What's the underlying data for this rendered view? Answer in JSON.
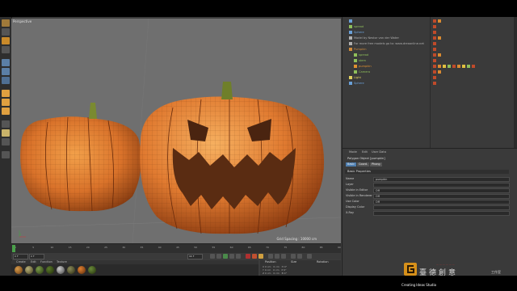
{
  "viewport": {
    "title": "Perspective",
    "grid_spacing": "Grid Spacing : 10000 cm"
  },
  "object_manager": {
    "objects": [
      {
        "name": "",
        "indent": 0,
        "color": "#6aa0d8"
      },
      {
        "name": "spread",
        "indent": 0,
        "color": "#8fbf5a"
      },
      {
        "name": "Sphere",
        "indent": 0,
        "color": "#6aa0d8"
      },
      {
        "name": "Model by Nestor van der Water",
        "indent": 0,
        "color": "#b0b0b0"
      },
      {
        "name": "For more free models go to: www.dreaonline.net",
        "indent": 0,
        "color": "#b0b0b0"
      },
      {
        "name": "Pumpkin",
        "indent": 0,
        "color": "#d08a3a"
      },
      {
        "name": "spread",
        "indent": 1,
        "color": "#8fbf5a"
      },
      {
        "name": "stem",
        "indent": 1,
        "color": "#8fbf5a"
      },
      {
        "name": "pumpkin",
        "indent": 1,
        "color": "#e09030"
      },
      {
        "name": "Camera",
        "indent": 1,
        "color": "#8fbf5a"
      },
      {
        "name": "Light",
        "indent": 0,
        "color": "#e0d060"
      },
      {
        "name": "Sphere",
        "indent": 0,
        "color": "#6aa0d8"
      }
    ]
  },
  "attributes": {
    "menu": [
      "Mode",
      "Edit",
      "User Data"
    ],
    "object_name": "Polygon Object [pumpkin]",
    "tabs": [
      "Basic",
      "Coord.",
      "Phong"
    ],
    "section": "Basic Properties",
    "rows": [
      {
        "label": "Name",
        "value": "pumpkin"
      },
      {
        "label": "Layer",
        "value": ""
      },
      {
        "label": "Visible in Editor",
        "value": "Off"
      },
      {
        "label": "Visible in Renderer",
        "value": "Off"
      },
      {
        "label": "Use Color",
        "value": "Off"
      },
      {
        "label": "Display Color",
        "value": ""
      },
      {
        "label": "X-Ray",
        "value": ""
      }
    ]
  },
  "timeline": {
    "ticks": [
      "0",
      "5",
      "10",
      "15",
      "20",
      "25",
      "30",
      "35",
      "40",
      "45",
      "50",
      "55",
      "60",
      "65",
      "70",
      "75",
      "80",
      "85",
      "90"
    ],
    "start_frame": "0 F",
    "end_frame": "90 F",
    "current_frame": "0 F"
  },
  "materials": {
    "menu": [
      "Create",
      "Edit",
      "Function",
      "Texture"
    ]
  },
  "coordinates": {
    "headers": [
      "Position",
      "Size",
      "Rotation"
    ],
    "rows": [
      {
        "axis": "X",
        "pos": "0 cm",
        "size": "0 cm",
        "rot": "H 0°"
      },
      {
        "axis": "Y",
        "pos": "0 cm",
        "size": "0 cm",
        "rot": "P 0°"
      },
      {
        "axis": "Z",
        "pos": "0 cm",
        "size": "0 cm",
        "rot": "B 0°"
      }
    ]
  },
  "watermark": {
    "brand_chinese": "臺德創意",
    "brand_small": "工作室",
    "brand_english": "Creating Ideas Studio",
    "brand_color": "#d6901a"
  }
}
